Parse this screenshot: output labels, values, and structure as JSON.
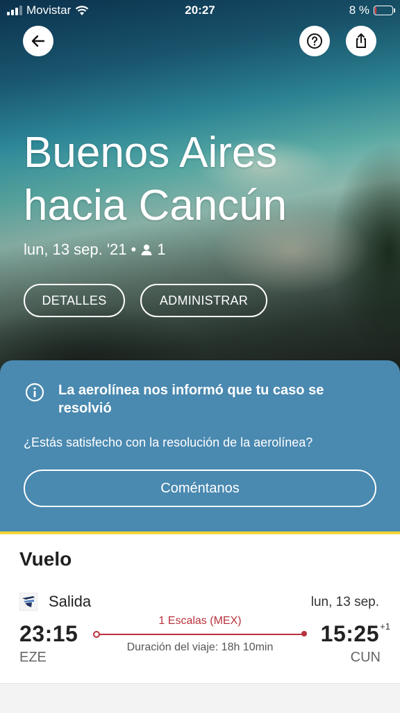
{
  "status_bar": {
    "carrier": "Movistar",
    "time": "20:27",
    "battery_percent": "8 %",
    "battery_level": 0.08
  },
  "hero": {
    "title_line1": "Buenos Aires",
    "title_line2": "hacia Cancún",
    "date": "lun, 13 sep. '21",
    "separator": "•",
    "passengers": "1",
    "buttons": {
      "details": "DETALLES",
      "manage": "ADMINISTRAR"
    },
    "icons": {
      "back": "arrow-left-icon",
      "help": "question-icon",
      "share": "share-icon",
      "person": "person-icon"
    }
  },
  "notice": {
    "title": "La aerolínea nos informó que tu caso se resolvió",
    "question": "¿Estás satisfecho con la resolución de la aerolínea?",
    "cta": "Coméntanos",
    "icon": "info-icon",
    "background_color": "#4a89b0",
    "accent_color": "#f4d435"
  },
  "flight": {
    "section_title": "Vuelo",
    "departure_label": "Salida",
    "date": "lun, 13 sep.",
    "depart_time": "23:15",
    "arrive_time": "15:25",
    "day_offset": "+1",
    "origin": "EZE",
    "destination": "CUN",
    "stops": "1 Escalas (MEX)",
    "duration": "Duración del viaje: 18h 10min",
    "route_color": "#b8323b"
  }
}
